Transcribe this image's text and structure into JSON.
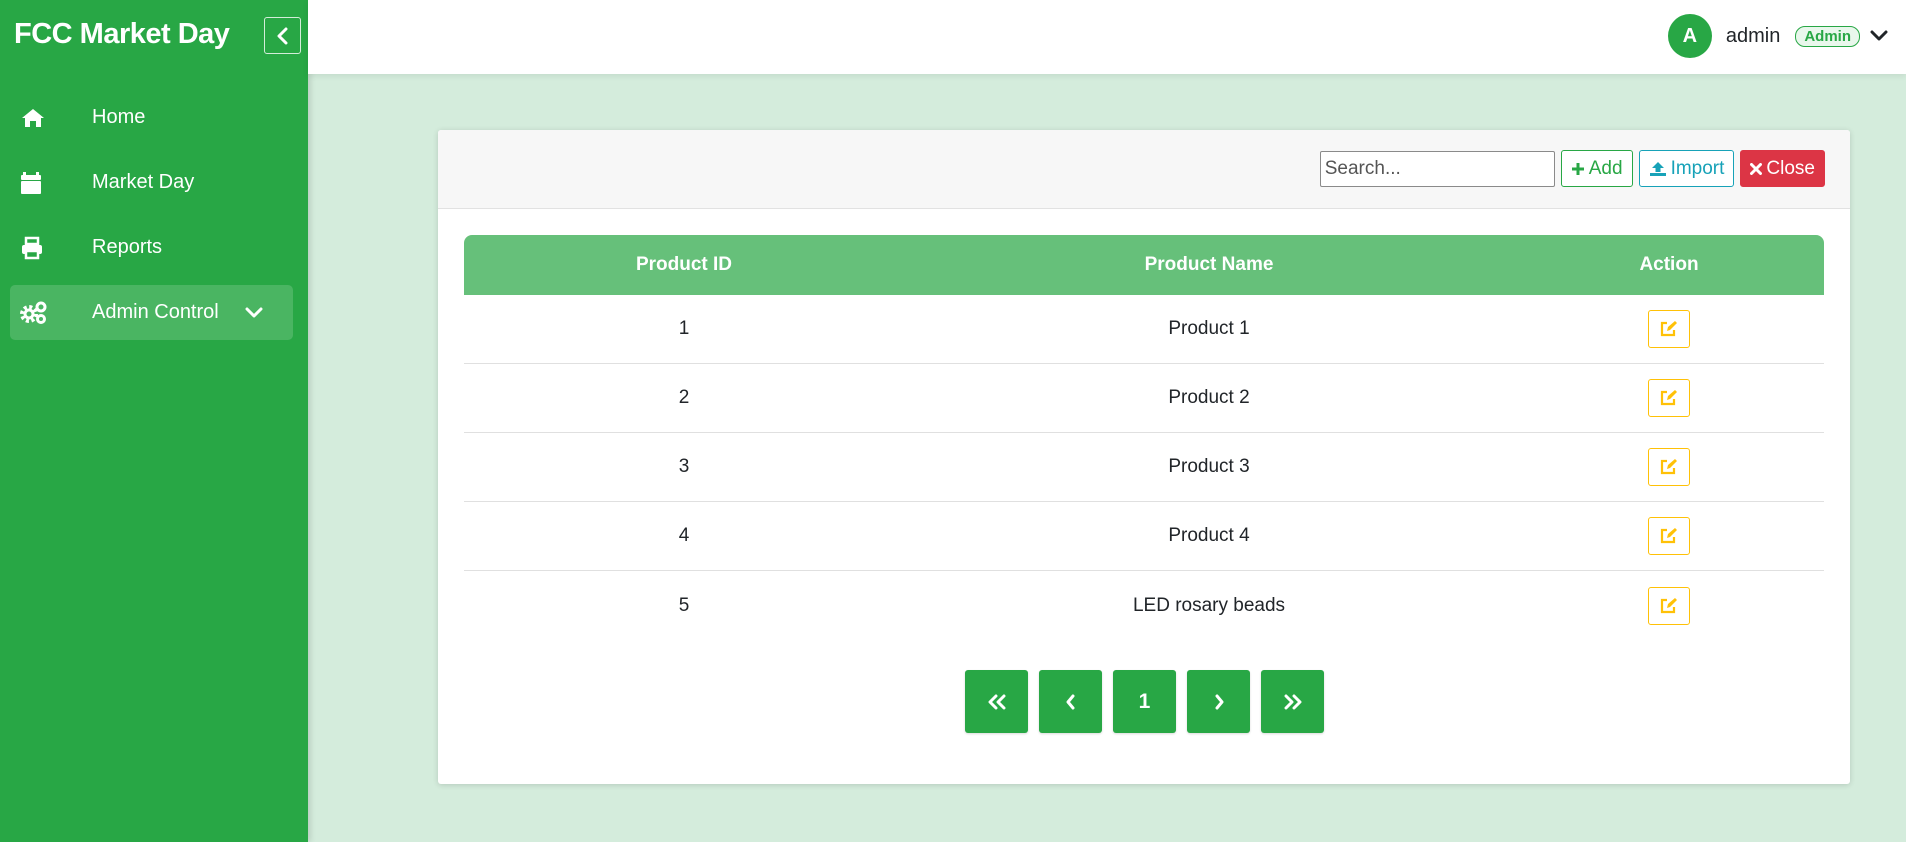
{
  "app": {
    "brand": "FCC Market Day"
  },
  "colors": {
    "primary": "#28a745",
    "header_row": "#66c07a",
    "background": "#d4ecdc",
    "info": "#17a2b8",
    "danger": "#dc3545",
    "warning": "#ffc107"
  },
  "sidebar": {
    "collapse_icon": "chevron-left-icon",
    "items": [
      {
        "label": "Home",
        "icon": "home-icon"
      },
      {
        "label": "Market Day",
        "icon": "calendar-icon"
      },
      {
        "label": "Reports",
        "icon": "printer-icon"
      },
      {
        "label": "Admin Control",
        "icon": "cogs-icon",
        "expandable": true
      }
    ]
  },
  "topbar": {
    "avatar_initial": "A",
    "username": "admin",
    "role": "Admin"
  },
  "toolbar": {
    "search_placeholder": "Search...",
    "add_label": "Add",
    "import_label": "Import",
    "close_label": "Close"
  },
  "table": {
    "columns": [
      "Product ID",
      "Product Name",
      "Action"
    ],
    "rows": [
      {
        "id": "1",
        "name": "Product 1"
      },
      {
        "id": "2",
        "name": "Product 2"
      },
      {
        "id": "3",
        "name": "Product 3"
      },
      {
        "id": "4",
        "name": "Product 4"
      },
      {
        "id": "5",
        "name": "LED rosary beads"
      }
    ]
  },
  "pagination": {
    "current_page": "1"
  }
}
